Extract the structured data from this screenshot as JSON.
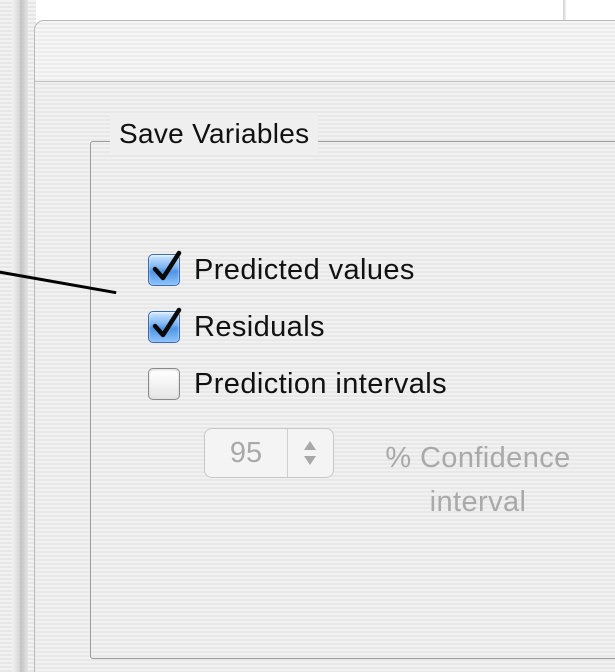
{
  "group": {
    "title": "Save Variables"
  },
  "options": [
    {
      "label": "Predicted values",
      "checked": true
    },
    {
      "label": "Residuals",
      "checked": true
    },
    {
      "label": "Prediction intervals",
      "checked": false
    }
  ],
  "confidence": {
    "value": "95",
    "label_line1": "% Confidence",
    "label_line2": "interval",
    "enabled": false
  },
  "icons": {
    "checkmark": "checkmark-icon",
    "stepper_up": "chevron-up-icon",
    "stepper_down": "chevron-down-icon"
  },
  "colors": {
    "checkbox_checked": "#4f94e4",
    "disabled_text": "#a9a9a9",
    "text": "#111111"
  }
}
